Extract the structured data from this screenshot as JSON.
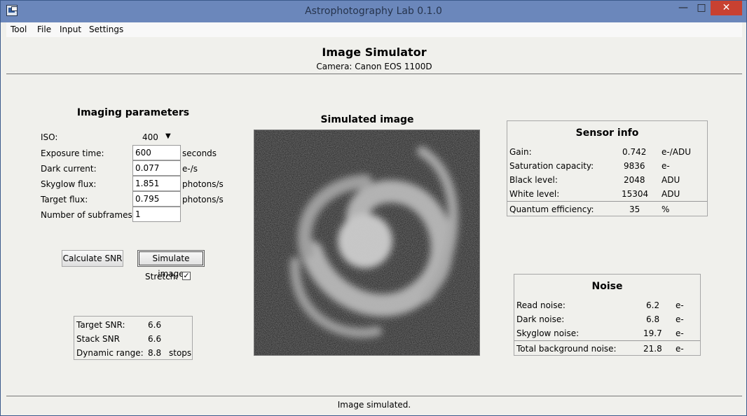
{
  "window": {
    "title": "Astrophotography Lab 0.1.0",
    "minimize": "—",
    "maximize": "□",
    "close": "✕"
  },
  "menu": {
    "items": [
      "Tool",
      "File",
      "Input",
      "Settings"
    ]
  },
  "header": {
    "title": "Image Simulator",
    "camera": "Camera: Canon EOS 1100D"
  },
  "imaging": {
    "title": "Imaging parameters",
    "iso_label": "ISO:",
    "iso_value": "400",
    "exposure_label": "Exposure time:",
    "exposure_value": "600",
    "exposure_unit": "seconds",
    "dark_label": "Dark current:",
    "dark_value": "0.077",
    "dark_unit": "e-/s",
    "skyglow_label": "Skyglow flux:",
    "skyglow_value": "1.851",
    "skyglow_unit": "photons/s",
    "target_label": "Target flux:",
    "target_value": "0.795",
    "target_unit": "photons/s",
    "subframes_label": "Number of subframes:",
    "subframes_value": "1"
  },
  "actions": {
    "calculate": "Calculate SNR",
    "simulate": "Simulate image",
    "stretch_label": "Stretch:",
    "stretch_checked": true
  },
  "results": {
    "target_snr_label": "Target SNR:",
    "target_snr_value": "6.6",
    "stack_snr_label": "Stack SNR",
    "stack_snr_value": "6.6",
    "dynamic_label": "Dynamic range:",
    "dynamic_value": "8.8",
    "dynamic_unit": "stops"
  },
  "simulated": {
    "title": "Simulated image"
  },
  "sensor": {
    "title": "Sensor info",
    "rows": [
      {
        "label": "Gain:",
        "value": "0.742",
        "unit": "e-/ADU"
      },
      {
        "label": "Saturation capacity:",
        "value": "9836",
        "unit": "e-"
      },
      {
        "label": "Black level:",
        "value": "2048",
        "unit": "ADU"
      },
      {
        "label": "White level:",
        "value": "15304",
        "unit": "ADU"
      },
      {
        "label": "Quantum efficiency:",
        "value": "35",
        "unit": "%"
      }
    ]
  },
  "noise": {
    "title": "Noise",
    "rows": [
      {
        "label": "Read noise:",
        "value": "6.2",
        "unit": "e-"
      },
      {
        "label": "Dark noise:",
        "value": "6.8",
        "unit": "e-"
      },
      {
        "label": "Skyglow noise:",
        "value": "19.7",
        "unit": "e-"
      },
      {
        "label": "Total background noise:",
        "value": "21.8",
        "unit": "e-"
      }
    ]
  },
  "status": {
    "text": "Image simulated."
  }
}
